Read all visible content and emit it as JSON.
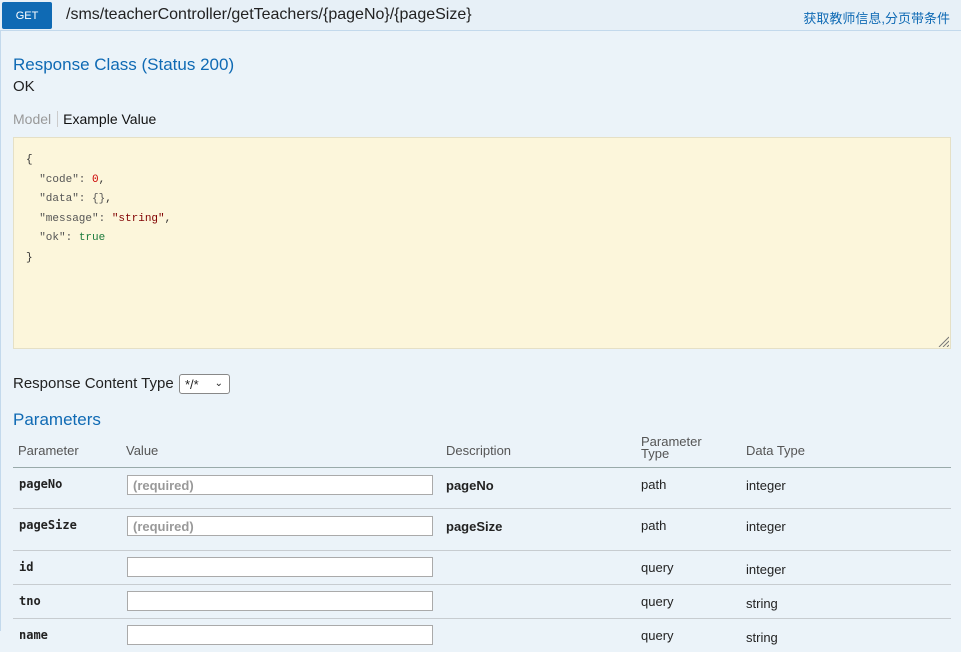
{
  "operation": {
    "method": "GET",
    "path": "/sms/teacherController/getTeachers/{pageNo}/{pageSize}",
    "summary": "获取教师信息,分页带条件"
  },
  "response": {
    "title": "Response Class (Status 200)",
    "status_text": "OK",
    "tabs": {
      "model": "Model",
      "example": "Example Value"
    },
    "example": {
      "open": "{",
      "close": "}",
      "code_key": "\"code\": ",
      "code_val": "0",
      "data_key": "\"data\": ",
      "data_val": "{}",
      "message_key": "\"message\": ",
      "message_val": "\"string\"",
      "ok_key": "\"ok\": ",
      "ok_val": "true"
    },
    "content_type_label": "Response Content Type",
    "content_type_value": "*/*"
  },
  "parameters": {
    "title": "Parameters",
    "headers": {
      "parameter": "Parameter",
      "value": "Value",
      "description": "Description",
      "param_type_1": "Parameter",
      "param_type_2": "Type",
      "data_type": "Data Type"
    },
    "rows": [
      {
        "name": "pageNo",
        "placeholder": "(required)",
        "description": "pageNo",
        "param_type": "path",
        "data_type": "integer"
      },
      {
        "name": "pageSize",
        "placeholder": "(required)",
        "description": "pageSize",
        "param_type": "path",
        "data_type": "integer"
      },
      {
        "name": "id",
        "placeholder": "",
        "description": "",
        "param_type": "query",
        "data_type": "integer"
      },
      {
        "name": "tno",
        "placeholder": "",
        "description": "",
        "param_type": "query",
        "data_type": "string"
      },
      {
        "name": "name",
        "placeholder": "",
        "description": "",
        "param_type": "query",
        "data_type": "string"
      }
    ]
  },
  "colors": {
    "accent": "#0f6ab4",
    "background": "#ebf3f9",
    "example_bg": "#fcf6db"
  }
}
